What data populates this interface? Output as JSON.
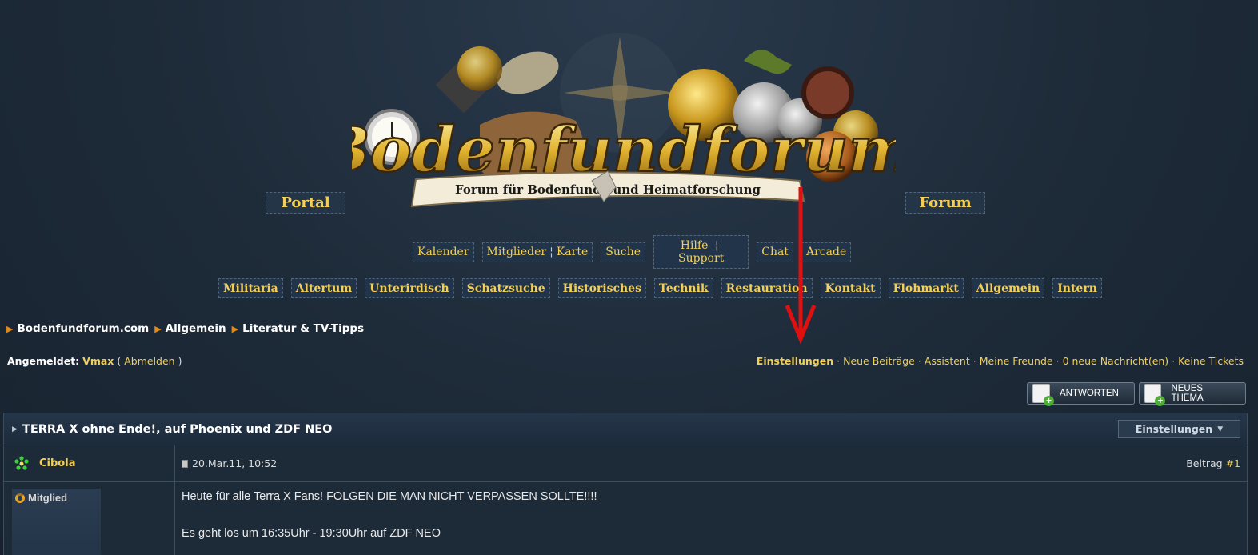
{
  "logo": {
    "title": "Bodenfundforum",
    "banner": "Forum für Bodenfunde und Heimatforschung"
  },
  "mainnav": {
    "portal": "Portal",
    "forum": "Forum"
  },
  "subnav": {
    "kalender": "Kalender",
    "mitglieder": "Mitglieder",
    "karte": "Karte",
    "suche": "Suche",
    "hilfe": "Hilfe",
    "support": "Support",
    "chat": "Chat",
    "arcade": "Arcade",
    "sep": "¦"
  },
  "categories": [
    "Militaria",
    "Altertum",
    "Unterirdisch",
    "Schatzsuche",
    "Historisches",
    "Technik",
    "Restauration",
    "Kontakt",
    "Flohmarkt",
    "Allgemein",
    "Intern"
  ],
  "breadcrumb": [
    "Bodenfundforum.com",
    "Allgemein",
    "Literatur & TV-Tipps"
  ],
  "userbar": {
    "label": "Angemeldet:",
    "username": "Vmax",
    "logout_open": "(",
    "logout": "Abmelden",
    "logout_close": ")",
    "links": [
      "Einstellungen",
      "Neue Beiträge",
      "Assistent",
      "Meine Freunde",
      "0 neue Nachricht(en)",
      "Keine Tickets"
    ],
    "dot": "·"
  },
  "buttons": {
    "reply": "ANTWORTEN",
    "new_thread": "NEUES THEMA"
  },
  "thread": {
    "title": "TERRA X ohne Ende!, auf Phoenix und ZDF NEO",
    "options": "Einstellungen"
  },
  "post": {
    "author": "Cibola",
    "date": "20.Mar.11, 10:52",
    "number_label": "Beitrag",
    "number": "#1",
    "rank": "Mitglied",
    "lines": [
      "Heute für alle Terra X Fans! FOLGEN DIE MAN NICHT VERPASSEN SOLLTE!!!!",
      "Es geht los um 16:35Uhr - 19:30Uhr auf ZDF NEO"
    ]
  },
  "colors": {
    "accent": "#f1cf58",
    "background": "#1d2a38",
    "annotation_arrow": "#e01010"
  }
}
